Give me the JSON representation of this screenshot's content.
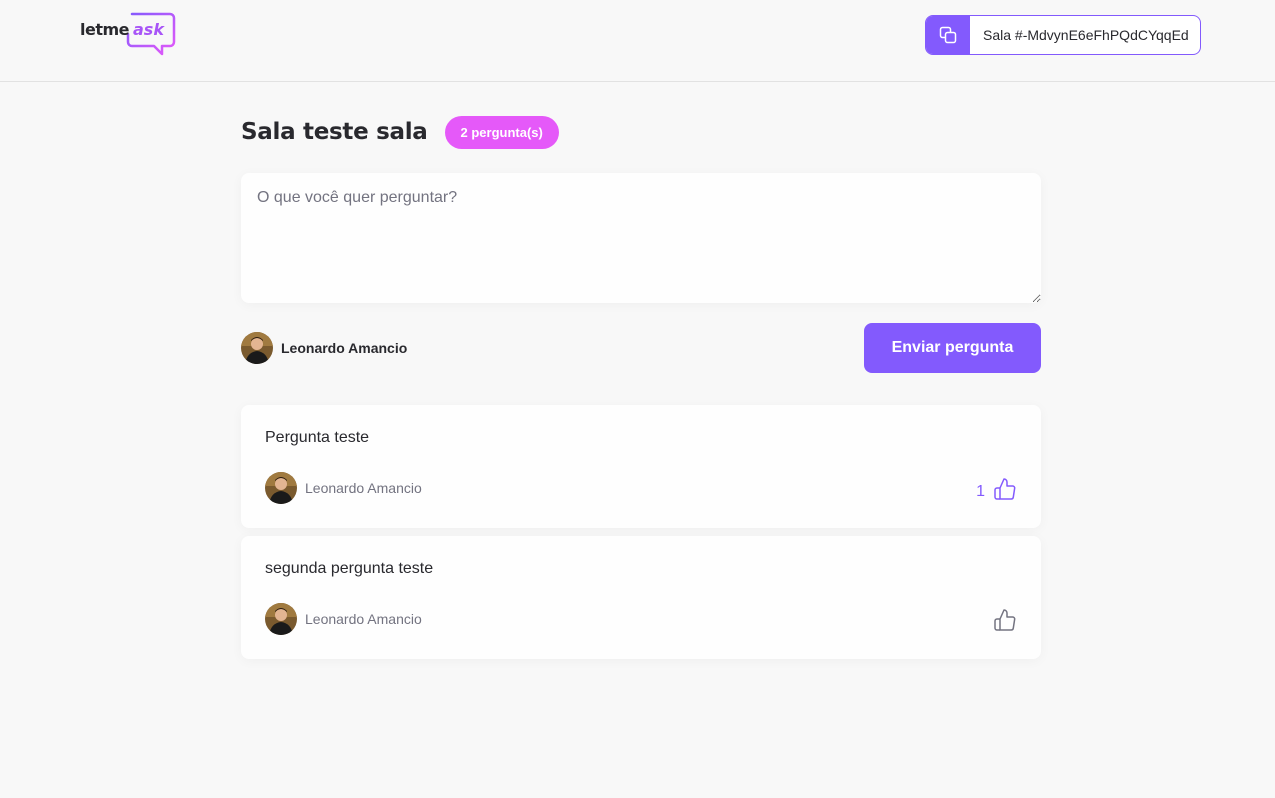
{
  "header": {
    "logo_text": "letme",
    "logo_accent": "ask",
    "room_code_label": "Sala #-MdvynE6eFhPQdCYqqEd"
  },
  "room": {
    "title": "Sala teste sala",
    "question_count_badge": "2 pergunta(s)"
  },
  "form": {
    "placeholder": "O que você quer perguntar?",
    "value": "",
    "user_name": "Leonardo Amancio",
    "send_label": "Enviar pergunta"
  },
  "questions": [
    {
      "content": "Pergunta teste",
      "author": "Leonardo Amancio",
      "like_count": "1",
      "liked": true
    },
    {
      "content": "segunda pergunta teste",
      "author": "Leonardo Amancio",
      "like_count": "",
      "liked": false
    }
  ],
  "icons": {
    "copy": "copy-icon",
    "like": "thumbs-up-icon",
    "avatar": "user-avatar"
  },
  "colors": {
    "accent": "#835afd",
    "badge": "#e559f9",
    "text": "#29292e",
    "muted": "#737380",
    "background": "#f8f8f8"
  }
}
